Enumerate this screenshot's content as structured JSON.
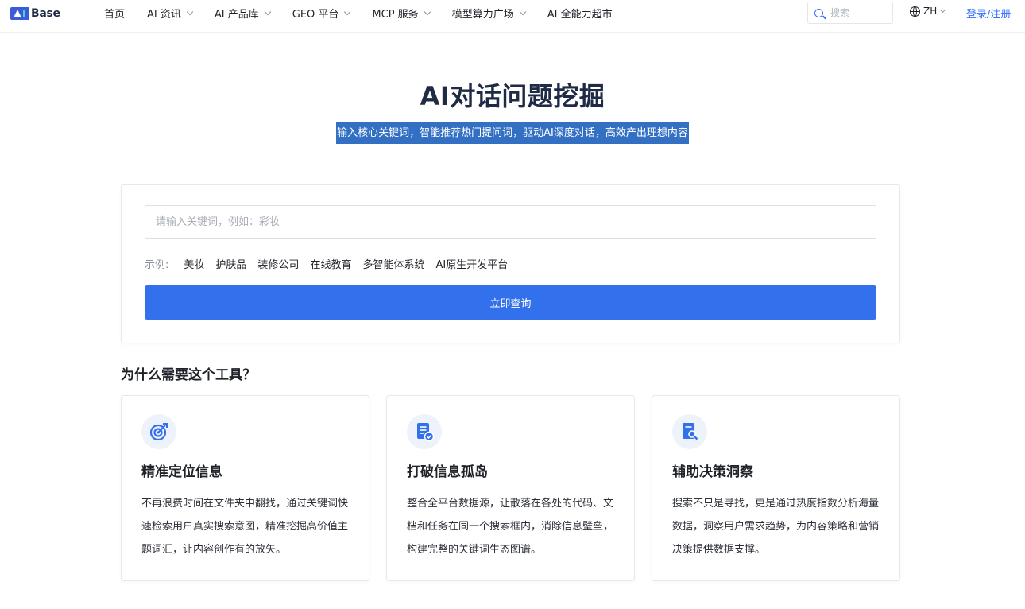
{
  "nav": {
    "logo_text": "Base",
    "items": [
      {
        "label": "首页",
        "has_dropdown": false
      },
      {
        "label": "AI 资讯",
        "has_dropdown": true
      },
      {
        "label": "AI 产品库",
        "has_dropdown": true
      },
      {
        "label": "GEO 平台",
        "has_dropdown": true
      },
      {
        "label": "MCP 服务",
        "has_dropdown": true
      },
      {
        "label": "模型算力广场",
        "has_dropdown": true
      },
      {
        "label": "AI 全能力超市",
        "has_dropdown": false
      }
    ],
    "search_placeholder": "搜索",
    "language": "ZH",
    "login_label": "登录/注册"
  },
  "hero": {
    "title": "AI对话问题挖掘",
    "subtitle": "输入核心关键词，智能推荐热门提问词，驱动AI深度对话，高效产出理想内容"
  },
  "query": {
    "input_value": "",
    "input_placeholder": "请输入关键词，例如：彩妆",
    "examples_label": "示例:",
    "examples": [
      "美妆",
      "护肤品",
      "装修公司",
      "在线教育",
      "多智能体系统",
      "AI原生开发平台"
    ],
    "submit_label": "立即查询"
  },
  "why": {
    "title": "为什么需要这个工具？",
    "cards": [
      {
        "icon": "target-icon",
        "title": "精准定位信息",
        "desc": "不再浪费时间在文件夹中翻找，通过关键词快速检索用户真实搜索意图，精准挖掘高价值主题词汇，让内容创作有的放矢。"
      },
      {
        "icon": "document-check-icon",
        "title": "打破信息孤岛",
        "desc": "整合全平台数据源，让散落在各处的代码、文档和任务在同一个搜索框内，消除信息壁垒，构建完整的关键词生态图谱。"
      },
      {
        "icon": "document-search-icon",
        "title": "辅助决策洞察",
        "desc": "搜索不只是寻找，更是通过热度指数分析海量数据，洞察用户需求趋势，为内容策略和营销决策提供数据支撑。"
      }
    ]
  },
  "colors": {
    "primary": "#3370eb",
    "link": "#3370ff",
    "title": "#1f2a44",
    "subtitle_highlight": "#3370c4",
    "icon_bg": "#eef2fb"
  }
}
